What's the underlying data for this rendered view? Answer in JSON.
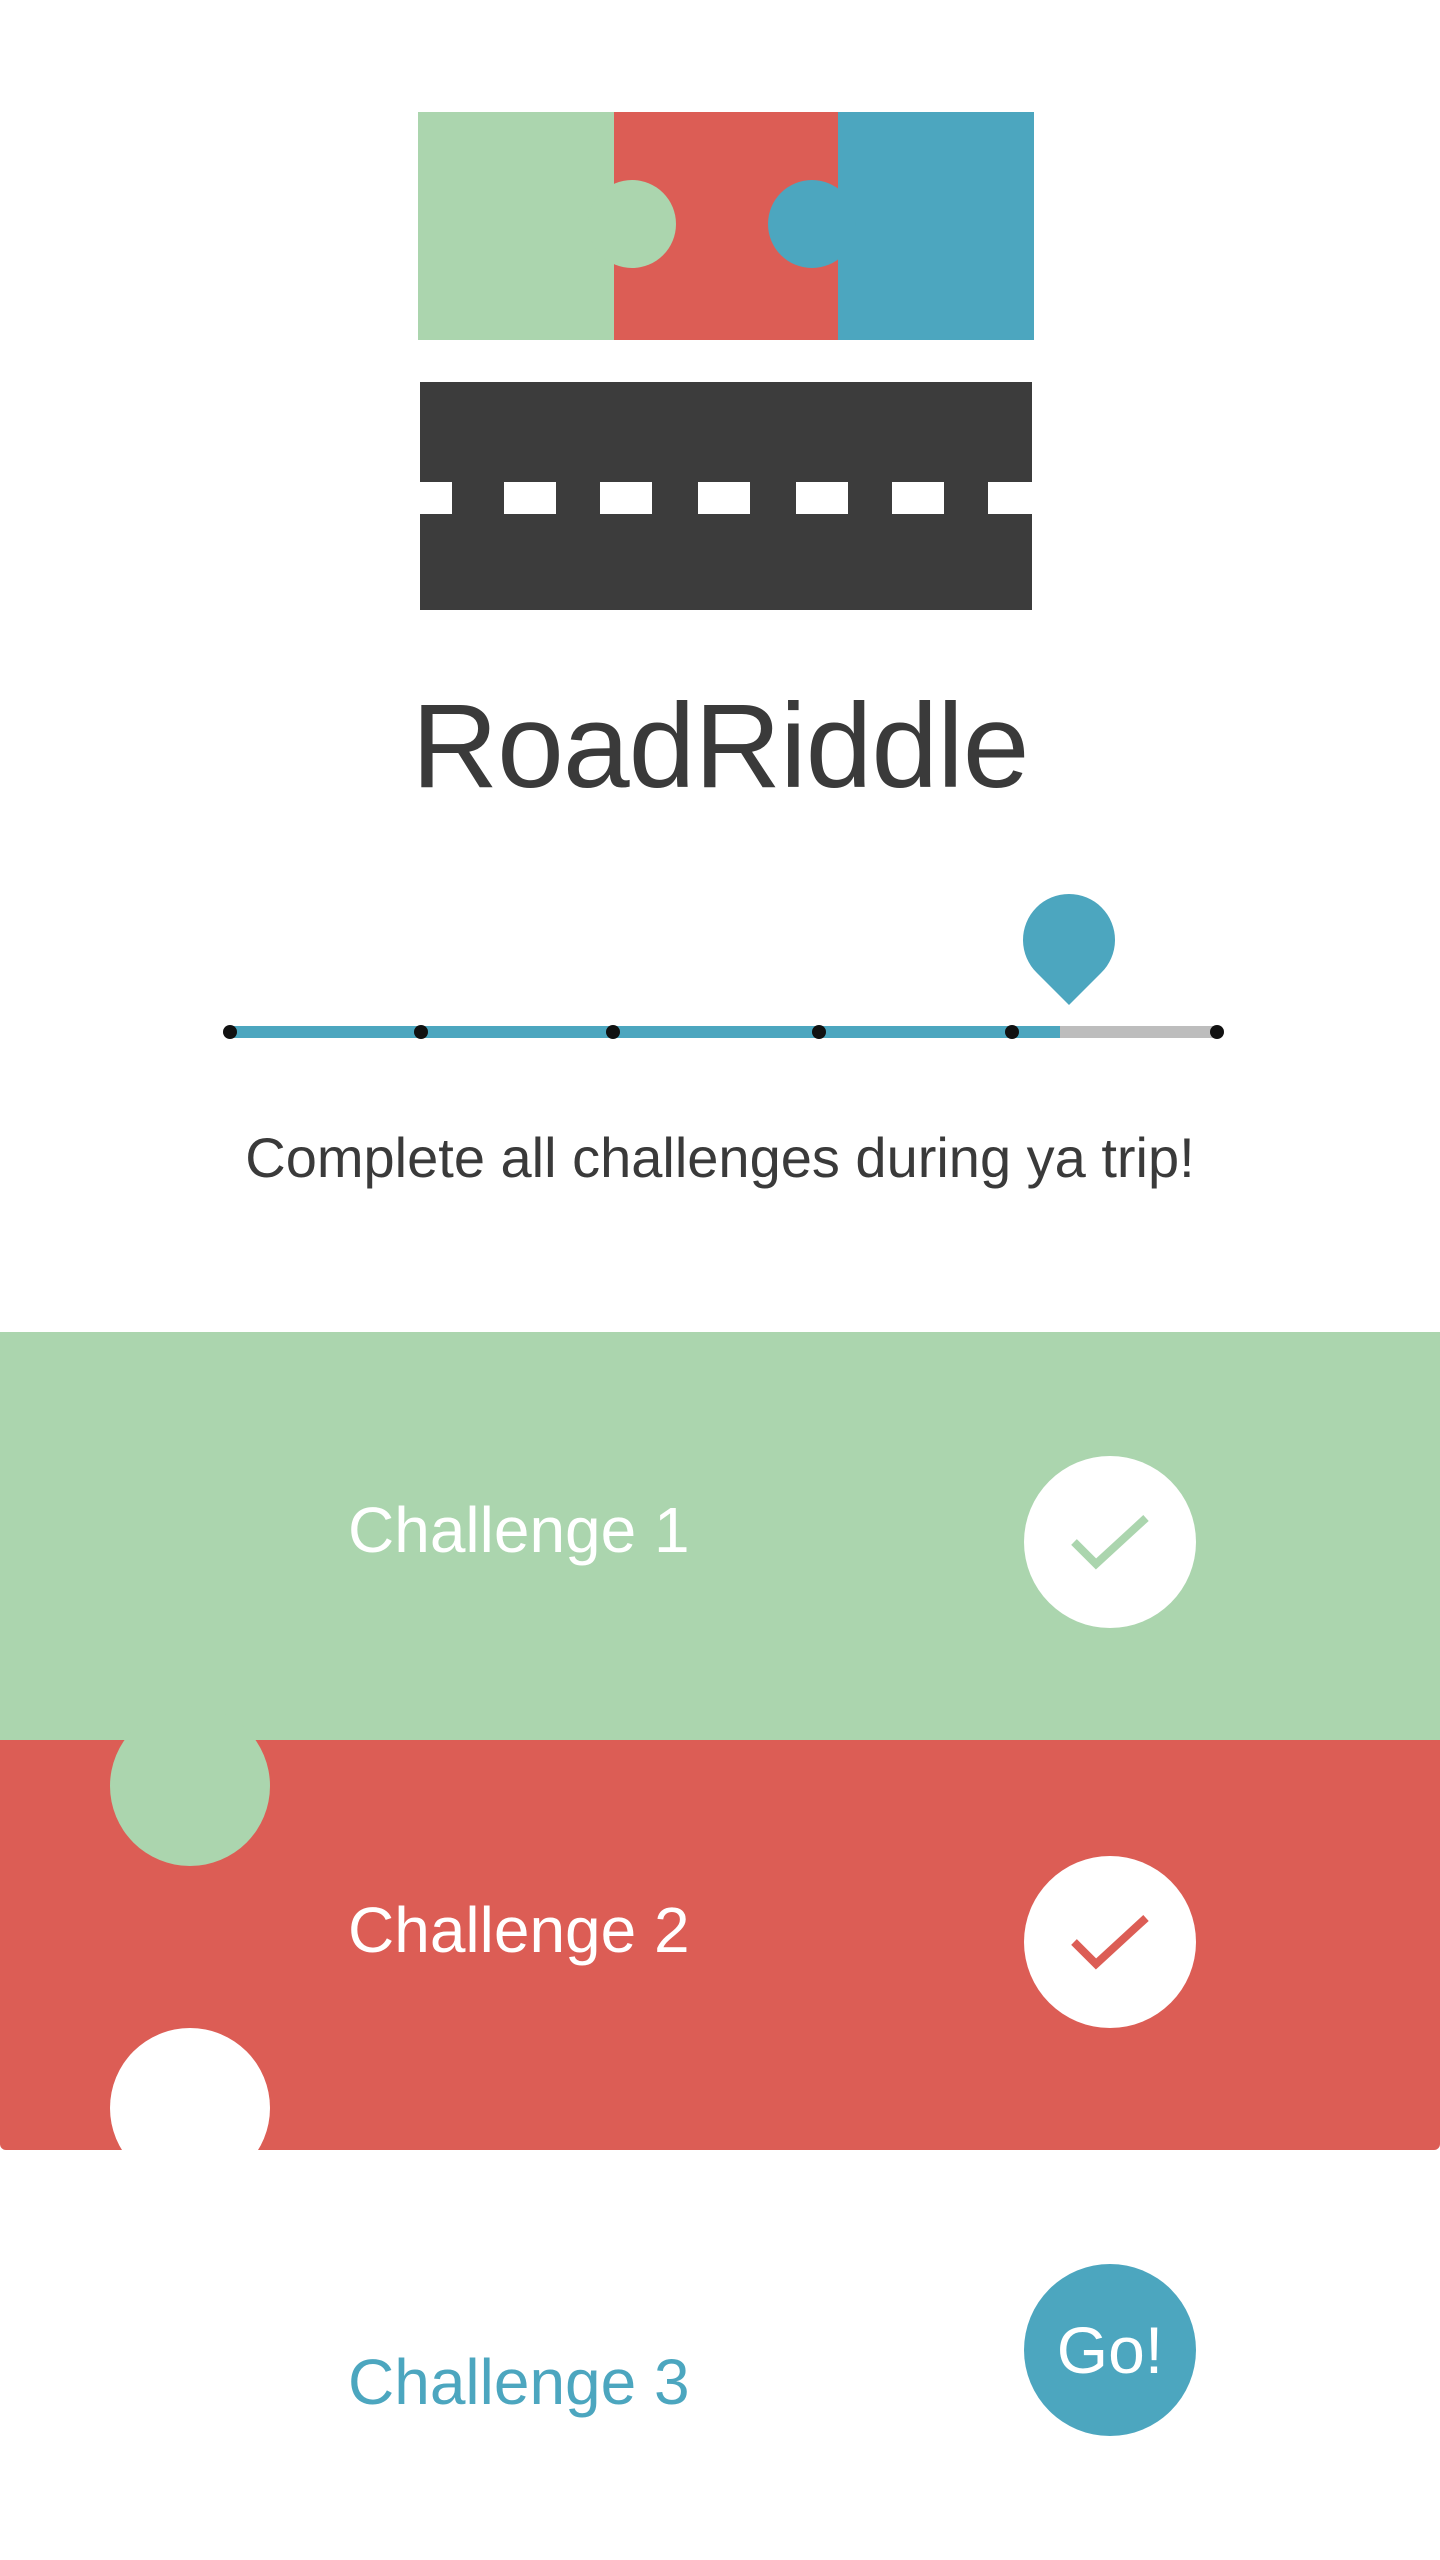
{
  "app": {
    "title": "RoadRiddle"
  },
  "logo": {
    "colors": {
      "green": "#abd5ae",
      "red": "#dc5d55",
      "blue": "#4ca6bf",
      "road": "#3c3c3c"
    }
  },
  "progress": {
    "fraction_complete": 0.84,
    "stops": 6,
    "fill_color": "#4ca6bf",
    "track_color": "#bdbdbd",
    "marker_icon": "map-pin-icon"
  },
  "subtitle": "Complete all challenges during ya trip!",
  "challenges": [
    {
      "label": "Challenge 1",
      "status": "completed",
      "icon": "checkmark-icon",
      "color": "#abd5ae"
    },
    {
      "label": "Challenge 2",
      "status": "completed",
      "icon": "checkmark-icon",
      "color": "#dc5d55"
    },
    {
      "label": "Challenge 3",
      "status": "current",
      "button_label": "Go!",
      "color": "#4ca6bf"
    }
  ]
}
